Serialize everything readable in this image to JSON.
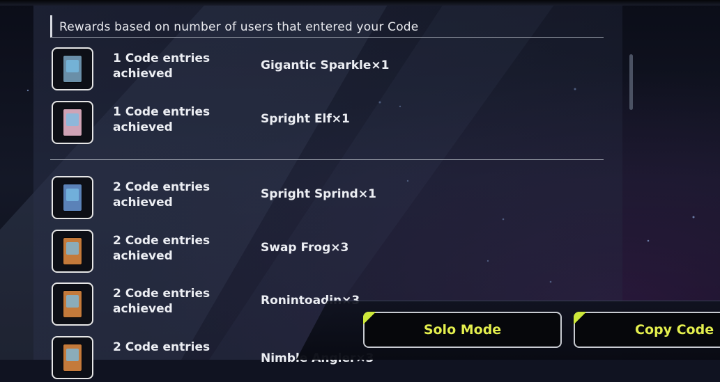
{
  "section": {
    "header": "Rewards based on number of users that entered your Code"
  },
  "rewards": [
    {
      "requirement": "1 Code entries achieved",
      "reward": "Gigantic Sparkle×1",
      "card_color": "#6a8fa8",
      "icon": "card-pack-icon"
    },
    {
      "requirement": "1 Code entries achieved",
      "reward": "Spright Elf×1",
      "card_color": "#cfa3b6",
      "icon": "card-icon"
    },
    {
      "requirement": "2 Code entries achieved",
      "reward": "Spright Sprind×1",
      "card_color": "#5b82b8",
      "icon": "card-icon"
    },
    {
      "requirement": "2 Code entries achieved",
      "reward": "Swap Frog×3",
      "card_color": "#c47a3b",
      "icon": "card-icon"
    },
    {
      "requirement": "2 Code entries achieved",
      "reward": "Ronintoadin×3",
      "card_color": "#c47a3b",
      "icon": "card-icon"
    },
    {
      "requirement": "2 Code entries",
      "reward": "Nimble Angler×3",
      "card_color": "#c47a3b",
      "icon": "card-icon"
    }
  ],
  "buttons": {
    "solo_mode": "Solo Mode",
    "copy_code": "Copy Code"
  },
  "colors": {
    "accent": "#e4ef4e",
    "text": "#eceef3"
  }
}
